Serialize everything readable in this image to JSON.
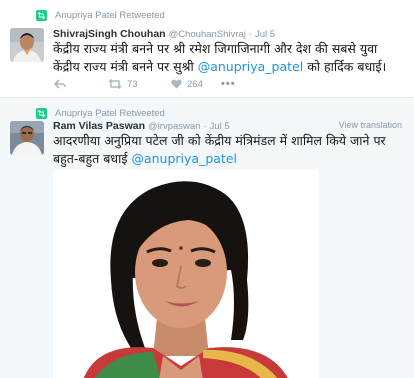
{
  "tweets": [
    {
      "retweet_context": "Anupriya Patel Retweeted",
      "display_name": "ShivrajSingh Chouhan",
      "handle": "@ChouhanShivraj",
      "separator": "·",
      "time": "Jul 5",
      "text_main": "केंद्रीय राज्य मंत्री बनने पर श्री रमेश जिगाजिनागी और देश की सबसे युवा केंद्रीय राज्य मंत्री बनने पर सुश्री ",
      "mention": "@anupriya_patel",
      "text_tail": " को हार्दिक बधाई।",
      "retweet_count": "73",
      "like_count": "264",
      "more_label": "•••"
    },
    {
      "retweet_context": "Anupriya Patel Retweeted",
      "display_name": "Ram Vilas Paswan",
      "handle": "@irvpaswan",
      "separator": "·",
      "time": "Jul 5",
      "view_translation": "View translation",
      "text_main": "आदरणीया अनुप्रिया पटेल जी को केंद्रीय मंत्रिमंडल में शामिल किये जाने पर बहुत-बहुत बधाई ",
      "mention": "@anupriya_patel"
    }
  ],
  "colors": {
    "retweet_green": "#19cf86",
    "link_blue": "#1b95e0",
    "meta_gray": "#8899a6",
    "alt_background": "#f5f8fa"
  },
  "icons": [
    "retweet-icon",
    "reply-icon",
    "heart-icon",
    "more-icon"
  ]
}
